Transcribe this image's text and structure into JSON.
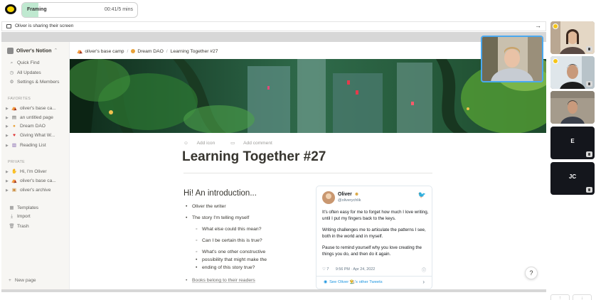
{
  "stage": {
    "label": "Framing",
    "timer": "00:41/5 mins",
    "progress_fraction": 0.14
  },
  "share_banner": {
    "text": "Oliver is sharing their screen",
    "arrow": "→"
  },
  "sidebar": {
    "workspace": "Oliver's Notion",
    "workspace_chevron": "⌃",
    "actions": [
      {
        "icon": "search-icon",
        "glyph": "⌕",
        "label": "Quick Find"
      },
      {
        "icon": "clock-icon",
        "glyph": "◷",
        "label": "All Updates"
      },
      {
        "icon": "gear-icon",
        "glyph": "⚙",
        "label": "Settings & Members"
      }
    ],
    "favorites_title": "FAVORITES",
    "favorites": [
      {
        "icon": "tent-emoji-icon",
        "glyph": "⛺",
        "label": "oliver's base ca..."
      },
      {
        "icon": "page-icon",
        "glyph": "▤",
        "label": "an untitled page"
      },
      {
        "icon": "orange-dot-icon",
        "glyph": "●",
        "label": "Dream DAO"
      },
      {
        "icon": "heart-emoji-icon",
        "glyph": "♥",
        "label": "Giving What W..."
      },
      {
        "icon": "books-emoji-icon",
        "glyph": "▥",
        "label": "Reading List"
      }
    ],
    "private_title": "PRIVATE",
    "private": [
      {
        "icon": "wave-emoji-icon",
        "glyph": "✋",
        "label": "Hi, I'm Oliver"
      },
      {
        "icon": "tent-emoji-icon",
        "glyph": "⛺",
        "label": "oliver's base ca..."
      },
      {
        "icon": "archive-emoji-icon",
        "glyph": "▣",
        "label": "oliver's archive"
      }
    ],
    "utilities": [
      {
        "icon": "templates-icon",
        "glyph": "▦",
        "label": "Templates"
      },
      {
        "icon": "import-icon",
        "glyph": "⤓",
        "label": "Import"
      },
      {
        "icon": "trash-icon",
        "glyph": "🗑",
        "label": "Trash"
      }
    ],
    "new_page": "New page"
  },
  "breadcrumb": {
    "items": [
      "oliver's base camp",
      "Dream DAO",
      "Learning Together #27"
    ],
    "separator": "/"
  },
  "document": {
    "add_icon": "Add icon",
    "add_comment": "Add comment",
    "title": "Learning Together #27",
    "intro_heading": "Hi! An introduction...",
    "bullets": [
      "Oliver the writer",
      "The story I'm telling myself"
    ],
    "sub_bullets": [
      "What else could this mean?",
      "Can I be certain this is true?",
      "What's one other constructive",
      "possibility that might make the",
      "ending of this story true?"
    ],
    "link_bullet": "Books belong to their readers"
  },
  "tweet": {
    "name": "Oliver",
    "handle": "@oliverychlik",
    "paragraphs": [
      "It's often easy for me to forget how much I love writing, until I put my fingers back to the keys.",
      "Writing challenges me to articulate the patterns I see, both in the world and in myself.",
      "Pause to remind yourself why you love creating the things you do, and then do it again."
    ],
    "likes": "7",
    "time": "9:56 PM · Apr 24, 2022",
    "see_more": "See Oliver 👨‍🌾's other Tweets",
    "colors": {
      "link": "#1b95e0",
      "bird": "#1da1f2"
    }
  },
  "help_label": "?",
  "participants": [
    {
      "kind": "video",
      "host": true
    },
    {
      "kind": "video",
      "host": true
    },
    {
      "kind": "video",
      "host": false
    },
    {
      "kind": "initials",
      "initials": "E"
    },
    {
      "kind": "initials",
      "initials": "JC"
    }
  ],
  "colors": {
    "accent": "#4aa8ef",
    "stage_fill": "#bfe9d0",
    "notion_sidebar": "#f7f6f3"
  }
}
